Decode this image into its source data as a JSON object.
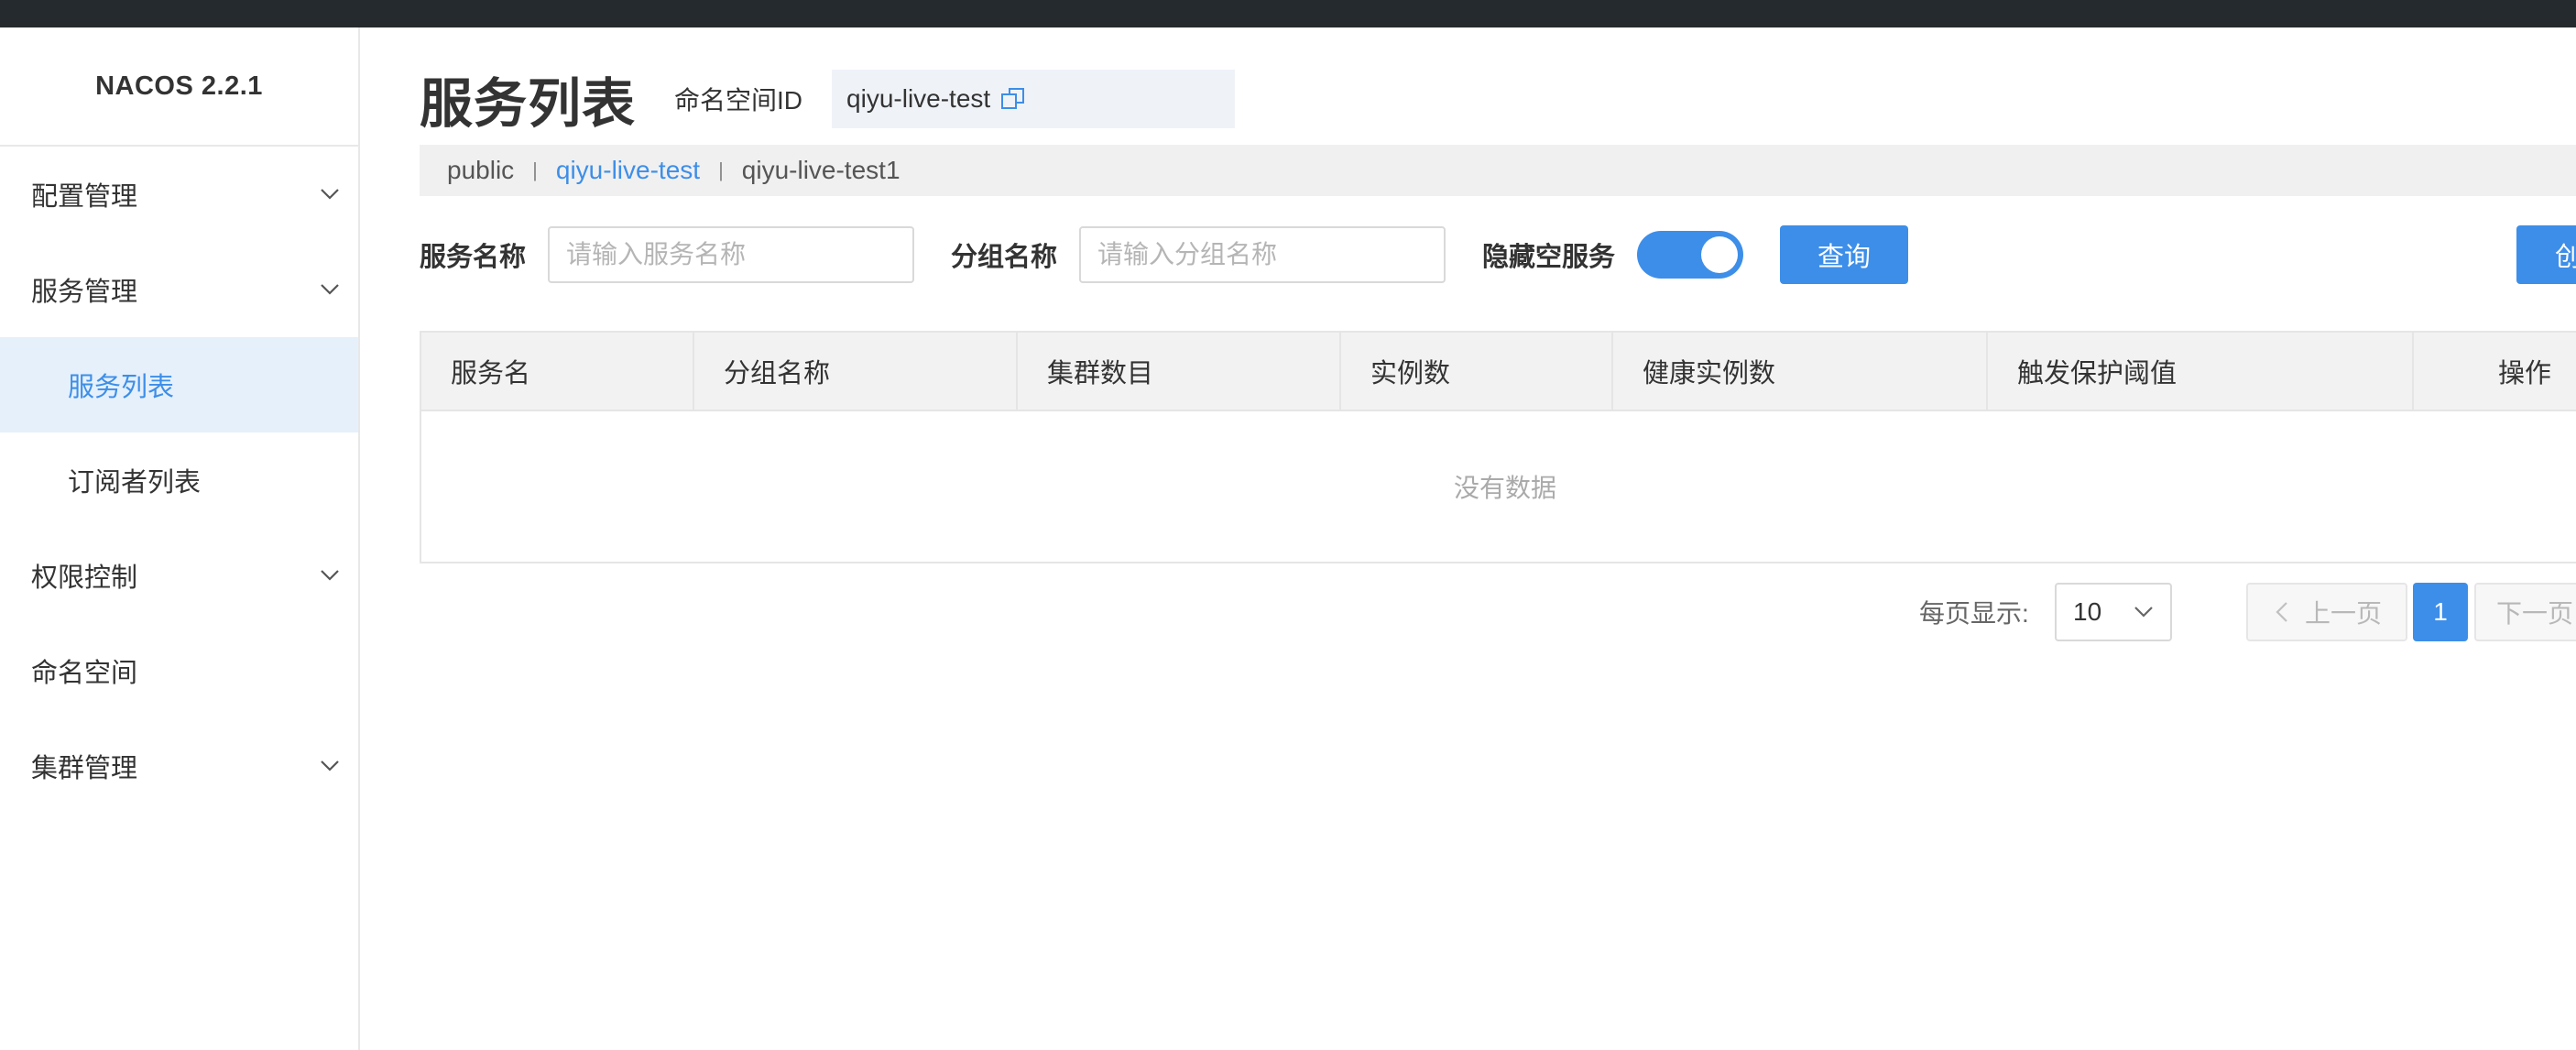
{
  "app": {
    "logo": "NACOS 2.2.1"
  },
  "sidebar": {
    "items": [
      {
        "label": "配置管理",
        "expandable": true
      },
      {
        "label": "服务管理",
        "expandable": true
      },
      {
        "label": "服务列表",
        "sub": true,
        "active": true
      },
      {
        "label": "订阅者列表",
        "sub": true
      },
      {
        "label": "权限控制",
        "expandable": true
      },
      {
        "label": "命名空间"
      },
      {
        "label": "集群管理",
        "expandable": true
      }
    ]
  },
  "header": {
    "title": "服务列表",
    "namespace_label": "命名空间ID",
    "namespace_id": "qiyu-live-test"
  },
  "namespaces": [
    {
      "label": "public"
    },
    {
      "label": "qiyu-live-test",
      "active": true
    },
    {
      "label": "qiyu-live-test1"
    }
  ],
  "namespace_separator": "|",
  "filters": {
    "service_name_label": "服务名称",
    "service_name_placeholder": "请输入服务名称",
    "group_name_label": "分组名称",
    "group_name_placeholder": "请输入分组名称",
    "hide_empty_label": "隐藏空服务",
    "hide_empty_on": true,
    "query_button": "查询",
    "create_button": "创建服务"
  },
  "table": {
    "columns": [
      "服务名",
      "分组名称",
      "集群数目",
      "实例数",
      "健康实例数",
      "触发保护阈值",
      "操作"
    ],
    "rows": [],
    "empty_text": "没有数据"
  },
  "pagination": {
    "per_page_label": "每页显示:",
    "per_page_value": "10",
    "prev_label": "上一页",
    "next_label": "下一页",
    "current_page": "1"
  },
  "colors": {
    "accent": "#3d8ee8",
    "topbar": "#252a2f",
    "active_bg": "#e5f0fb"
  }
}
